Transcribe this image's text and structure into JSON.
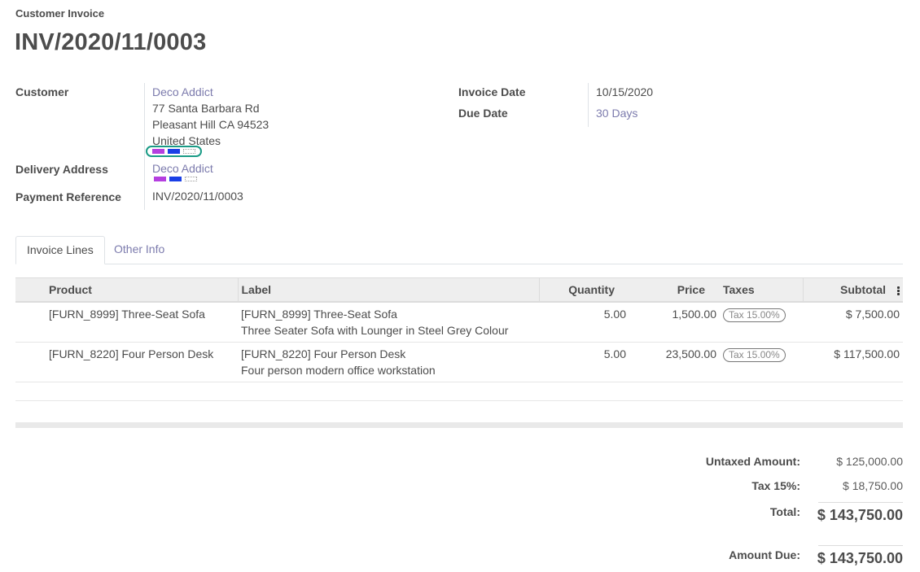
{
  "header": {
    "doc_type": "Customer Invoice",
    "invoice_number": "INV/2020/11/0003"
  },
  "customer": {
    "label": "Customer",
    "name": "Deco Addict",
    "address_line1": "77 Santa Barbara Rd",
    "address_line2": "Pleasant Hill CA 94523",
    "country": "United States",
    "tags": [
      "#b53fe0",
      "#1a3fe6",
      "empty"
    ]
  },
  "delivery": {
    "label": "Delivery Address",
    "name": "Deco Addict",
    "tags": [
      "#b53fe0",
      "#1a3fe6",
      "empty"
    ]
  },
  "payment_reference": {
    "label": "Payment Reference",
    "value": "INV/2020/11/0003"
  },
  "invoice_date": {
    "label": "Invoice Date",
    "value": "10/15/2020"
  },
  "due_date": {
    "label": "Due Date",
    "value": "30 Days"
  },
  "tabs": [
    {
      "label": "Invoice Lines",
      "active": true
    },
    {
      "label": "Other Info",
      "active": false
    }
  ],
  "table": {
    "columns": [
      "Product",
      "Label",
      "Quantity",
      "Price",
      "Taxes",
      "Subtotal"
    ],
    "rows": [
      {
        "product": "[FURN_8999] Three-Seat Sofa",
        "label": "[FURN_8999] Three-Seat Sofa",
        "description": "Three Seater Sofa with Lounger in Steel Grey Colour",
        "quantity": "5.00",
        "price": "1,500.00",
        "tax": "Tax 15.00%",
        "subtotal": "$ 7,500.00"
      },
      {
        "product": "[FURN_8220] Four Person Desk",
        "label": "[FURN_8220] Four Person Desk",
        "description": "Four person modern office workstation",
        "quantity": "5.00",
        "price": "23,500.00",
        "tax": "Tax 15.00%",
        "subtotal": "$ 117,500.00"
      }
    ]
  },
  "totals": {
    "untaxed_label": "Untaxed Amount:",
    "untaxed_value": "$ 125,000.00",
    "tax_label": "Tax 15%:",
    "tax_value": "$ 18,750.00",
    "total_label": "Total:",
    "total_value": "$ 143,750.00",
    "amount_due_label": "Amount Due:",
    "amount_due_value": "$ 143,750.00"
  },
  "icons": {
    "column_options": "kebab-icon"
  }
}
